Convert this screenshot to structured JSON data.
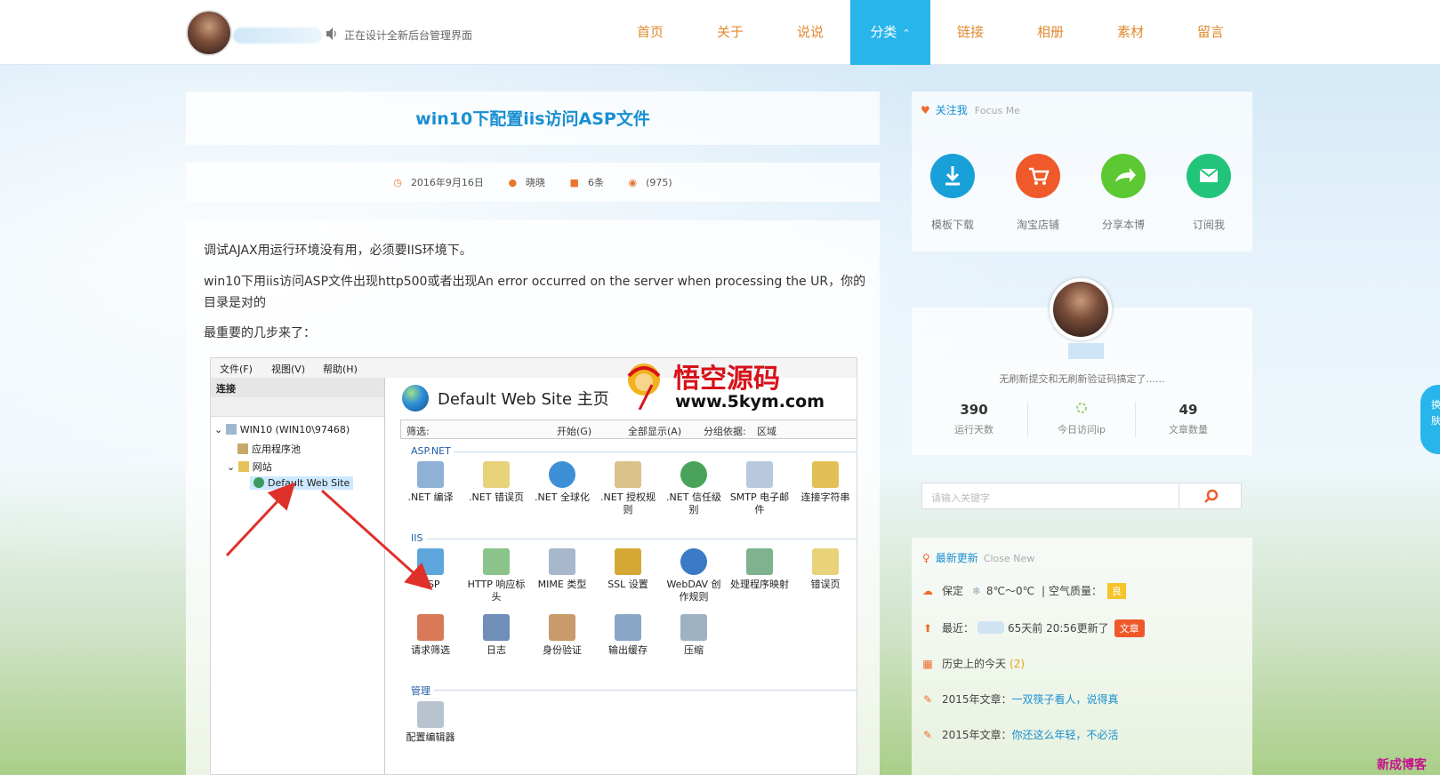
{
  "header": {
    "notice": "正在设计全新后台管理界面",
    "nav": [
      "首页",
      "关于",
      "说说",
      "分类",
      "链接",
      "相册",
      "素材",
      "留言"
    ],
    "active_index": 3,
    "active_chevron": "⌃"
  },
  "post": {
    "title": "win10下配置iis访问ASP文件",
    "date": "2016年9月16日",
    "author": "晓晓",
    "comments": "6条",
    "views": "(975)",
    "para1": "调试AJAX用运行环境没有用，必须要IIS环境下。",
    "para2": "win10下用iis访问ASP文件出现http500或者出现An error occurred on the server when processing the UR，你的目录是对的",
    "para3": "最重要的几步来了："
  },
  "iis": {
    "menu": [
      "文件(F)",
      "视图(V)",
      "帮助(H)"
    ],
    "connections_title": "连接",
    "tree": {
      "server": "WIN10 (WIN10\\97468)",
      "app_pools": "应用程序池",
      "sites": "网站",
      "default_site": "Default Web Site"
    },
    "site_header": "Default Web Site 主页",
    "filter": {
      "label": "筛选:",
      "start": "开始(G)",
      "show_all": "全部显示(A)",
      "group_by": "分组依据:",
      "group_value": "区域"
    },
    "groups": {
      "aspnet": "ASP.NET",
      "iis": "IIS",
      "management": "管理"
    },
    "aspnet_features": [
      ".NET 编译",
      ".NET 错误页",
      ".NET 全球化",
      ".NET 授权规则",
      ".NET 信任级别",
      "SMTP 电子邮件",
      "连接字符串"
    ],
    "iis_features_row1": [
      "ASP",
      "HTTP 响应标头",
      "MIME 类型",
      "SSL 设置",
      "WebDAV 创作规则",
      "处理程序映射",
      "错误页"
    ],
    "iis_features_row2": [
      "请求筛选",
      "日志",
      "身份验证",
      "输出缓存",
      "压缩"
    ],
    "management_features": [
      "配置编辑器"
    ]
  },
  "logo_watermark": {
    "title": "悟空源码",
    "url": "www.5kym.com"
  },
  "sidebar": {
    "follow": {
      "title": "关注我",
      "subtitle": "Focus Me",
      "buttons": [
        {
          "label": "模板下载",
          "color": "#1aa0d8",
          "icon": "download-icon"
        },
        {
          "label": "淘宝店铺",
          "color": "#f05a2a",
          "icon": "cart-icon"
        },
        {
          "label": "分享本博",
          "color": "#5cc832",
          "icon": "share-icon"
        },
        {
          "label": "订阅我",
          "color": "#22c47a",
          "icon": "mail-icon"
        }
      ]
    },
    "profile": {
      "desc": "无刷新提交和无刷新验证码搞定了......",
      "stats": [
        {
          "num": "390",
          "label": "运行天数"
        },
        {
          "num": "",
          "label": "今日访问ip"
        },
        {
          "num": "49",
          "label": "文章数量"
        }
      ]
    },
    "search": {
      "placeholder": "请输入关键字"
    },
    "recent": {
      "title": "最新更新",
      "subtitle": "Close New",
      "weather_city": "保定",
      "weather_temp": "8℃～0℃",
      "weather_sep": "|",
      "weather_air": "空气质量：",
      "weather_air_value": "良",
      "latest_label": "最近：",
      "latest_text": "65天前 20:56更新了",
      "latest_tag": "文章",
      "history": "历史上的今天",
      "history_count": "(2)",
      "article1_prefix": "2015年文章：",
      "article1_link": "一双筷子看人，说得真",
      "article2_prefix": "2015年文章：",
      "article2_link": "你还这么年轻，不必活"
    }
  },
  "float_tab": {
    "line1": "换",
    "line2": "肤"
  },
  "corner_watermark": "新成博客",
  "colors": {
    "accent": "#28b5eb",
    "nav_text": "#e08a2f",
    "title_blue": "#1a8fd2",
    "orange": "#f06b2c"
  }
}
